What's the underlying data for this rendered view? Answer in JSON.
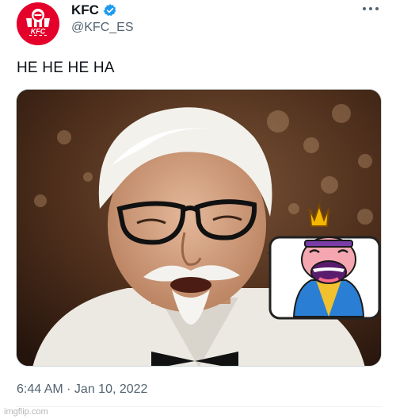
{
  "author": {
    "display_name": "KFC",
    "handle": "@KFC_ES",
    "avatar_icon": "kfc-logo",
    "avatar_text": "KFC",
    "verified_icon": "verified-badge-icon",
    "verified_color": "#1d9bf0"
  },
  "menu": {
    "more_icon": "more-options-icon"
  },
  "tweet": {
    "text": "HE HE HE HA",
    "timestamp": "6:44 AM · Jan 10, 2022"
  },
  "media": {
    "icon": "colonel-sanders-laughing-with-king-emote"
  },
  "watermark": {
    "text": "imgflip.com"
  },
  "colors": {
    "brand_red": "#e4002b",
    "text_primary": "#0f1419",
    "text_secondary": "#536471"
  }
}
